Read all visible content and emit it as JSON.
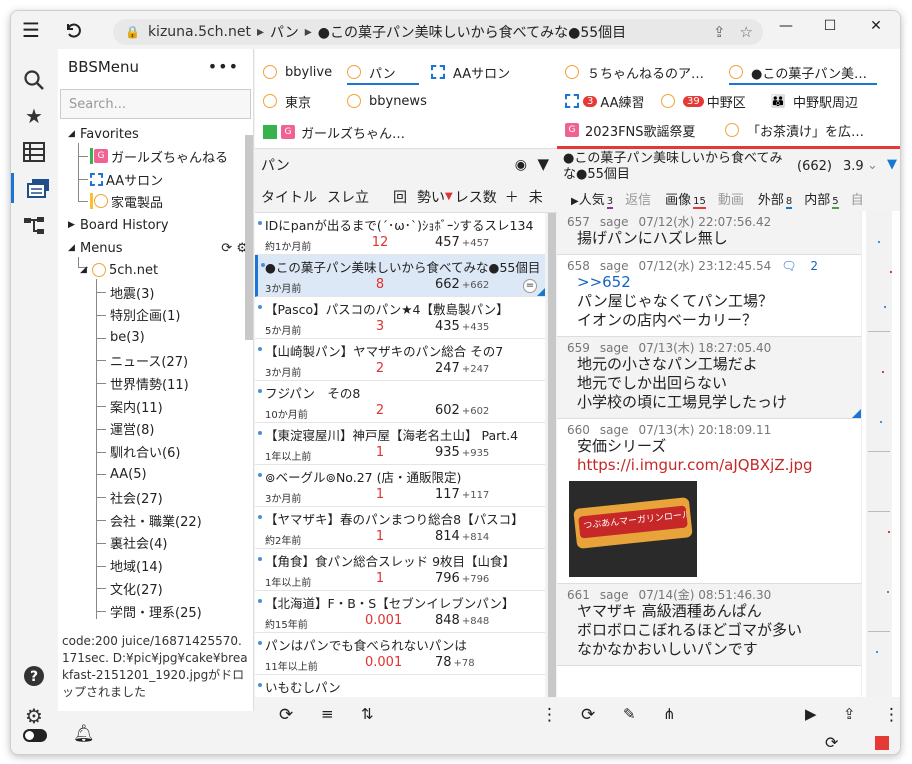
{
  "url": {
    "host": "kizuna.5ch.net",
    "crumb1": "パン",
    "crumb2": "●この菓子パン美味しいから食べてみな●55個目"
  },
  "menu": {
    "title": "BBSMenu",
    "search_placeholder": "Search...",
    "favorites_label": "Favorites",
    "favorites": [
      "ガールズちゃんねる",
      "AAサロン",
      "家電製品"
    ],
    "board_history": "Board History",
    "menus_label": "Menus",
    "root": "5ch.net",
    "categories": [
      "地震(3)",
      "特別企画(1)",
      "be(3)",
      "ニュース(27)",
      "世界情勢(11)",
      "案内(11)",
      "運営(8)",
      "馴れ合い(6)",
      "AA(5)",
      "社会(27)",
      "会社・職業(22)",
      "裏社会(4)",
      "地域(14)",
      "文化(27)",
      "学問・理系(25)"
    ]
  },
  "status_text": "code:200 juice/16871425570.171sec. D:¥pic¥jpg¥cake¥breakfast-2151201_1920.jpgがドロップされました",
  "board_tabs": [
    "bbylive",
    "パン",
    "AAサロン",
    "東京",
    "bbynews",
    "ガールズちゃん…"
  ],
  "board_header": "パン",
  "columns": {
    "title": "タイトル",
    "thread": "スレ立",
    "count_ico": "回",
    "momentum": "勢い",
    "res": "レス数",
    "plus": "＋",
    "unread": "未"
  },
  "threads": [
    {
      "title": "IDにpanが出るまで(´･ω･`)ｼｮﾎﾞｰﾝするスレ134",
      "age": "約1か月前",
      "rate": "12",
      "count": "457",
      "new": "+457"
    },
    {
      "title": "●この菓子パン美味しいから食べてみな●55個目",
      "age": "3か月前",
      "rate": "8",
      "count": "662",
      "new": "+662",
      "selected": true
    },
    {
      "title": "【Pasco】パスコのパン★4【敷島製パン】",
      "age": "5か月前",
      "rate": "3",
      "count": "435",
      "new": "+435"
    },
    {
      "title": "【山崎製パン】ヤマザキのパン総合 その7",
      "age": "3か月前",
      "rate": "2",
      "count": "247",
      "new": "+247"
    },
    {
      "title": "フジパン　その8",
      "age": "10か月前",
      "rate": "2",
      "count": "602",
      "new": "+602"
    },
    {
      "title": "【東淀寝屋川】神戸屋【海老名土山】 Part.4",
      "age": "1年以上前",
      "rate": "1",
      "count": "935",
      "new": "+935"
    },
    {
      "title": "⊚ベーグル⊚No.27 (店・通販限定)",
      "age": "3か月前",
      "rate": "1",
      "count": "117",
      "new": "+117"
    },
    {
      "title": "【ヤマザキ】春のパンまつり総合8【パスコ】",
      "age": "約2年前",
      "rate": "1",
      "count": "814",
      "new": "+814"
    },
    {
      "title": "【角食】食パン総合スレッド 9枚目【山食】",
      "age": "1年以上前",
      "rate": "1",
      "count": "796",
      "new": "+796"
    },
    {
      "title": "【北海道】F・B・S【セブンイレブンパン】",
      "age": "約15年前",
      "rate": "0.001",
      "count": "848",
      "new": "+848"
    },
    {
      "title": "パンはパンでも食べられないパンは",
      "age": "11年以上前",
      "rate": "0.001",
      "count": "78",
      "new": "+78"
    },
    {
      "title": "いもむしパン",
      "age": "",
      "rate": "",
      "count": "",
      "new": ""
    }
  ],
  "thread_tabs": [
    "５ちゃんねるのア…",
    "●この菓子パン美…",
    "AA練習",
    "中野区",
    "中野駅周辺",
    "2023FNS歌謡祭夏",
    "「お茶漬け」を広…"
  ],
  "thread_tab_badges": {
    "aa": "3",
    "nakano": "39"
  },
  "thread_header": {
    "title": "●この菓子パン美味しいから食べてみな●55個目",
    "count": "(662)",
    "momentum": "3.9"
  },
  "filters": [
    {
      "label": "人気",
      "n": "3",
      "active": true
    },
    {
      "label": "返信",
      "n": "",
      "active": false
    },
    {
      "label": "画像",
      "n": "15",
      "active": true
    },
    {
      "label": "動画",
      "n": "",
      "active": false
    },
    {
      "label": "外部",
      "n": "8",
      "active": true
    },
    {
      "label": "内部",
      "n": "5",
      "active": true
    },
    {
      "label": "自",
      "n": "",
      "active": false
    }
  ],
  "posts": [
    {
      "num": "657",
      "name": "sage",
      "date": "07/12(水) 22:07:56.42",
      "body": "揚げパンにハズレ無し"
    },
    {
      "num": "658",
      "name": "sage",
      "date": "07/12(水) 23:12:45.54",
      "replies": "2",
      "anchor": ">>652",
      "body": "パン屋じゃなくてパン工場？\nイオンの店内ベーカリー？"
    },
    {
      "num": "659",
      "name": "sage",
      "date": "07/13(木) 18:27:05.40",
      "body": "地元の小さなパン工場だよ\n地元でしか出回らない\n小学校の頃に工場見学したっけ"
    },
    {
      "num": "660",
      "name": "sage",
      "date": "07/13(木) 20:18:09.11",
      "body": "安価シリーズ",
      "link": "https://i.imgur.com/aJQBXjZ.jpg",
      "img_text": "つぶあんマーガリンロール"
    },
    {
      "num": "661",
      "name": "sage",
      "date": "07/14(金) 08:51:46.30",
      "body": "ヤマザキ 高級酒種あんぱん\nボロボロこぼれるほどゴマが多い\nなかなかおいしいパンです"
    }
  ]
}
